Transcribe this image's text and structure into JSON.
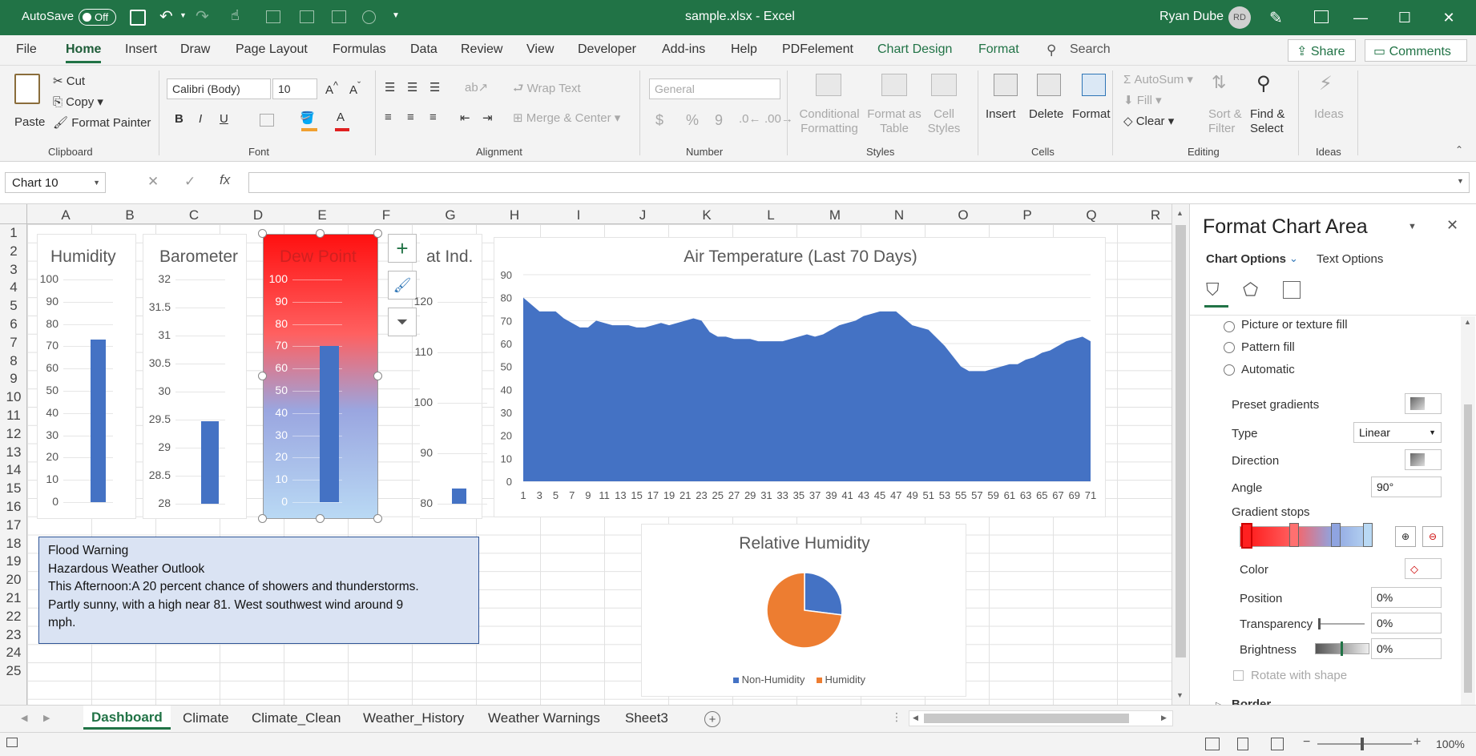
{
  "window": {
    "autosave_label": "AutoSave",
    "autosave_state": "Off",
    "file_title": "sample.xlsx  -  Excel",
    "user_name": "Ryan Dube",
    "user_initials": "RD"
  },
  "ribbon_tabs": [
    "File",
    "Home",
    "Insert",
    "Draw",
    "Page Layout",
    "Formulas",
    "Data",
    "Review",
    "View",
    "Developer",
    "Add-ins",
    "Help",
    "PDFelement",
    "Chart Design",
    "Format"
  ],
  "search_label": "Search",
  "share_label": "Share",
  "comments_label": "Comments",
  "ribbon": {
    "paste": "Paste",
    "cut": "Cut",
    "copy": "Copy",
    "format_painter": "Format Painter",
    "font_name": "Calibri (Body)",
    "font_size": "10",
    "bold": "B",
    "italic": "I",
    "underline": "U",
    "wrap_text": "Wrap Text",
    "merge_center": "Merge & Center",
    "number_format": "General",
    "currency": "$",
    "percent": "%",
    "comma": "9",
    "cond_fmt_1": "Conditional",
    "cond_fmt_2": "Formatting",
    "format_table_1": "Format as",
    "format_table_2": "Table",
    "cell_styles_1": "Cell",
    "cell_styles_2": "Styles",
    "insert": "Insert",
    "delete": "Delete",
    "format": "Format",
    "autosum": "AutoSum",
    "fill": "Fill",
    "clear": "Clear",
    "sort_1": "Sort &",
    "sort_2": "Filter",
    "find_1": "Find &",
    "find_2": "Select",
    "ideas": "Ideas",
    "groups": {
      "clipboard": "Clipboard",
      "font": "Font",
      "alignment": "Alignment",
      "number": "Number",
      "styles": "Styles",
      "cells": "Cells",
      "editing": "Editing",
      "ideas": "Ideas"
    }
  },
  "formula_bar": {
    "name_box": "Chart 10",
    "fx": "fx",
    "cancel": "✕",
    "enter": "✓",
    "formula": ""
  },
  "columns": [
    "A",
    "B",
    "C",
    "D",
    "E",
    "F",
    "G",
    "H",
    "I",
    "J",
    "K",
    "L",
    "M",
    "N",
    "O",
    "P",
    "Q",
    "R"
  ],
  "rows": [
    "1",
    "2",
    "3",
    "4",
    "5",
    "6",
    "7",
    "8",
    "9",
    "10",
    "11",
    "12",
    "13",
    "14",
    "15",
    "16",
    "17",
    "18",
    "19",
    "20",
    "21",
    "22",
    "23",
    "24",
    "25"
  ],
  "charts": {
    "humidity": {
      "title": "Humidity",
      "ticks": [
        "100",
        "90",
        "80",
        "70",
        "60",
        "50",
        "40",
        "30",
        "20",
        "10",
        "0"
      ],
      "value": 73
    },
    "barometer": {
      "title": "Barometer",
      "ticks": [
        "32",
        "31.5",
        "31",
        "30.5",
        "30",
        "29.5",
        "29",
        "28.5",
        "28"
      ],
      "value": 29.47
    },
    "dewpoint": {
      "title": "Dew Point",
      "ticks": [
        "100",
        "90",
        "80",
        "70",
        "60",
        "50",
        "40",
        "30",
        "20",
        "10",
        "0"
      ],
      "value": 70
    },
    "heatindex": {
      "title": "at Ind.",
      "ticks": [
        "120",
        "110",
        "100",
        "90",
        "80"
      ],
      "value": 83
    },
    "airtemp": {
      "title": "Air Temperature (Last 70 Days)",
      "yticks": [
        "90",
        "80",
        "70",
        "60",
        "50",
        "40",
        "30",
        "20",
        "10",
        "0"
      ],
      "xticks": [
        "1",
        "3",
        "5",
        "7",
        "9",
        "11",
        "13",
        "15",
        "17",
        "19",
        "21",
        "23",
        "25",
        "27",
        "29",
        "31",
        "33",
        "35",
        "37",
        "39",
        "41",
        "43",
        "45",
        "47",
        "49",
        "51",
        "53",
        "55",
        "57",
        "59",
        "61",
        "63",
        "65",
        "67",
        "69",
        "71"
      ]
    },
    "relhum": {
      "title": "Relative Humidity",
      "legend": [
        "Non-Humidity",
        "Humidity"
      ],
      "colors": [
        "#4472c4",
        "#ed7d31"
      ]
    }
  },
  "chart_data": [
    {
      "type": "bar",
      "title": "Humidity",
      "categories": [
        ""
      ],
      "values": [
        73
      ],
      "ylim": [
        0,
        100
      ]
    },
    {
      "type": "bar",
      "title": "Barometer",
      "categories": [
        ""
      ],
      "values": [
        29.47
      ],
      "ylim": [
        28,
        32
      ]
    },
    {
      "type": "bar",
      "title": "Dew Point",
      "categories": [
        ""
      ],
      "values": [
        70
      ],
      "ylim": [
        0,
        100
      ]
    },
    {
      "type": "bar",
      "title": "at Ind.",
      "categories": [
        ""
      ],
      "values": [
        83
      ],
      "ylim": [
        80,
        125
      ]
    },
    {
      "type": "area",
      "title": "Air Temperature (Last 70 Days)",
      "x": [
        1,
        2,
        3,
        4,
        5,
        6,
        7,
        8,
        9,
        10,
        11,
        12,
        13,
        14,
        15,
        16,
        17,
        18,
        19,
        20,
        21,
        22,
        23,
        24,
        25,
        26,
        27,
        28,
        29,
        30,
        31,
        32,
        33,
        34,
        35,
        36,
        37,
        38,
        39,
        40,
        41,
        42,
        43,
        44,
        45,
        46,
        47,
        48,
        49,
        51,
        53,
        55,
        56,
        57,
        58,
        59,
        60,
        61,
        62,
        63,
        64,
        65,
        66,
        67,
        68,
        69,
        70,
        71
      ],
      "values": [
        80,
        77,
        74,
        74,
        74,
        71,
        69,
        67,
        67,
        70,
        69,
        68,
        68,
        68,
        67,
        67,
        68,
        69,
        68,
        69,
        70,
        71,
        70,
        65,
        63,
        63,
        62,
        62,
        62,
        61,
        61,
        61,
        61,
        62,
        63,
        64,
        63,
        64,
        66,
        68,
        69,
        70,
        72,
        73,
        74,
        74,
        74,
        71,
        68,
        66,
        59,
        50,
        48,
        48,
        48,
        49,
        50,
        51,
        51,
        53,
        54,
        56,
        57,
        59,
        61,
        62,
        63,
        61
      ],
      "ylim": [
        0,
        90
      ]
    },
    {
      "type": "pie",
      "title": "Relative Humidity",
      "categories": [
        "Non-Humidity",
        "Humidity"
      ],
      "values": [
        27,
        73
      ]
    }
  ],
  "flood": {
    "line1": "Flood Warning",
    "line2": "Hazardous Weather Outlook",
    "line3": "This Afternoon:A 20 percent chance of showers and thunderstorms.",
    "line4": "Partly sunny, with a high near 81. West southwest wind around 9",
    "line5": "mph."
  },
  "pane": {
    "title": "Format Chart Area",
    "chart_options": "Chart Options",
    "text_options": "Text Options",
    "picture_fill": "Picture or texture fill",
    "pattern_fill": "Pattern fill",
    "automatic": "Automatic",
    "preset_gradients": "Preset gradients",
    "type": "Type",
    "type_value": "Linear",
    "direction": "Direction",
    "angle": "Angle",
    "angle_value": "90°",
    "gradient_stops": "Gradient stops",
    "color": "Color",
    "position": "Position",
    "position_value": "0%",
    "transparency": "Transparency",
    "transparency_value": "0%",
    "brightness": "Brightness",
    "brightness_value": "0%",
    "rotate_with_shape": "Rotate with shape",
    "border": "Border"
  },
  "sheets": [
    "Dashboard",
    "Climate",
    "Climate_Clean",
    "Weather_History",
    "Weather Warnings",
    "Sheet3"
  ],
  "status": {
    "zoom": "100%"
  }
}
